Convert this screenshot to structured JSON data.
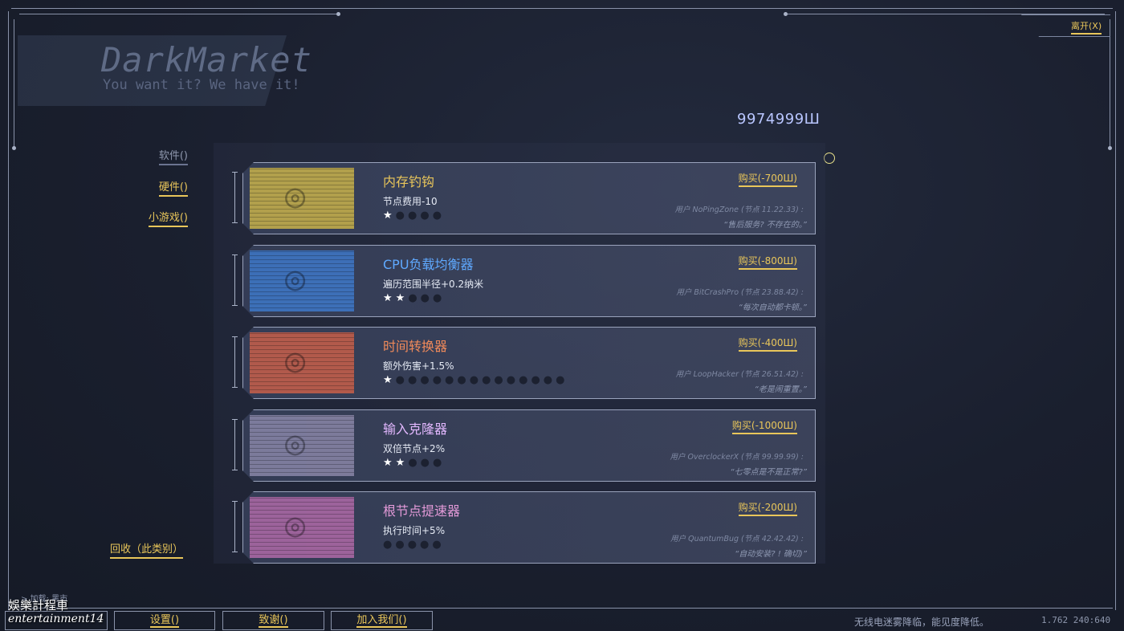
{
  "header": {
    "exit_label": "离开(X)",
    "brand_title": "DarkMarket",
    "brand_subtitle": "You want it? We have it!",
    "balance": "9974999Ш"
  },
  "categories": [
    {
      "label": "软件()",
      "active": false
    },
    {
      "label": "硬件()",
      "active": true
    },
    {
      "label": "小游戏()",
      "active": true
    }
  ],
  "items": [
    {
      "name": "内存钓钩",
      "color": "#e9c65a",
      "thumb_color": "#c8b24a",
      "effect": "节点费用-10",
      "stars_on": 1,
      "stars_total": 5,
      "buy": "购买(-700Ш)",
      "review_user": "用户 NoPingZone (节点 11.22.33) :",
      "review_text": "“售后服务? 不存在的。”"
    },
    {
      "name": "CPU负载均衡器",
      "color": "#5fa9ff",
      "thumb_color": "#3f78c8",
      "effect": "遍历范围半径+0.2纳米",
      "stars_on": 2,
      "stars_total": 5,
      "buy": "购买(-800Ш)",
      "review_user": "用户 BitCrashPro (节点 23.88.42) :",
      "review_text": "“每次自动都卡顿。”"
    },
    {
      "name": "时间转换器",
      "color": "#f08a5a",
      "thumb_color": "#c8604a",
      "effect": "额外伤害+1.5%",
      "stars_on": 1,
      "stars_total": 15,
      "buy": "购买(-400Ш)",
      "review_user": "用户 LoopHacker (节点 26.51.42) :",
      "review_text": "“老是闹重置。”"
    },
    {
      "name": "输入克隆器",
      "color": "#e3b8ff",
      "thumb_color": "#8a86a8",
      "effect": "双倍节点+2%",
      "stars_on": 2,
      "stars_total": 5,
      "buy": "购买(-1000Ш)",
      "review_user": "用户 OverclockerX (节点 99.99.99) :",
      "review_text": "“七零点是不是正常?”"
    },
    {
      "name": "根节点提速器",
      "color": "#e39ad8",
      "thumb_color": "#b06aa8",
      "effect": "执行时间+5%",
      "stars_on": 0,
      "stars_total": 5,
      "buy": "购买(-200Ш)",
      "review_user": "用户 QuantumBug (节点 42.42.42) :",
      "review_text": "“自动安装? ! 确切)”"
    }
  ],
  "footer": {
    "recycle_label": "回收（此类别）",
    "load_status": "> 加载: 黑市",
    "buttons": [
      {
        "label": ""
      },
      {
        "label": "设置()"
      },
      {
        "label": "致谢()"
      },
      {
        "label": "加入我们()"
      }
    ],
    "watermark_line1": "娛樂計程車",
    "watermark_line2": "entertainment14",
    "notice": "无线电迷雾降临，能见度降低。",
    "version": "1.762 240:640"
  },
  "colors": {
    "accent": "#e9c65a",
    "balance": "#b9c6ff",
    "background": "#1a1f2e"
  }
}
